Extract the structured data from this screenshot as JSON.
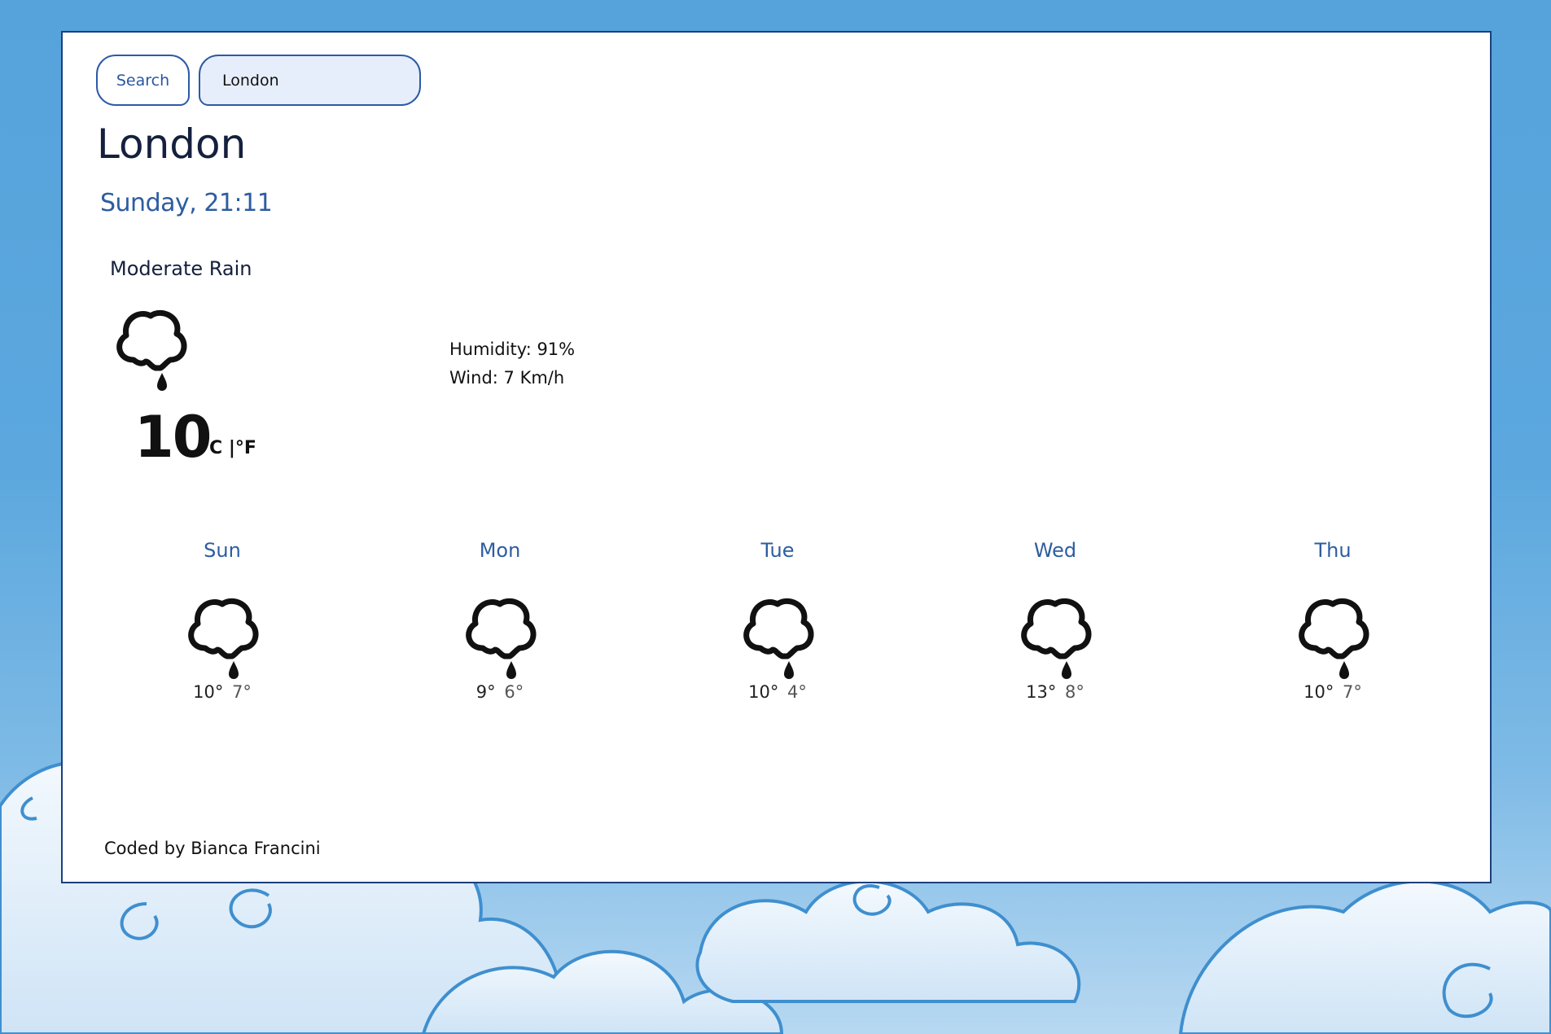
{
  "search": {
    "button_label": "Search",
    "input_value": "London"
  },
  "current": {
    "city": "London",
    "datetime": "Sunday, 21:11",
    "description": "Moderate Rain",
    "icon": "rain-cloud-icon",
    "temperature": "10",
    "unit_celsius": "°C",
    "unit_separator": " |",
    "unit_fahrenheit": "°F",
    "humidity": "Humidity: 91%",
    "wind": "Wind: 7 Km/h"
  },
  "forecast": [
    {
      "day": "Sun",
      "max": "10°",
      "min": "7°",
      "icon": "rain-cloud-icon"
    },
    {
      "day": "Mon",
      "max": "9°",
      "min": "6°",
      "icon": "rain-cloud-icon"
    },
    {
      "day": "Tue",
      "max": "10°",
      "min": "4°",
      "icon": "rain-cloud-icon"
    },
    {
      "day": "Wed",
      "max": "13°",
      "min": "8°",
      "icon": "rain-cloud-icon"
    },
    {
      "day": "Thu",
      "max": "10°",
      "min": "7°",
      "icon": "rain-cloud-icon"
    }
  ],
  "footer": {
    "credit": "Coded by Bianca Francini"
  },
  "colors": {
    "page_background": "#56a3db",
    "card_border": "#1c3f7c",
    "accent_blue": "#2d5da0",
    "input_background": "#e7eefb"
  }
}
